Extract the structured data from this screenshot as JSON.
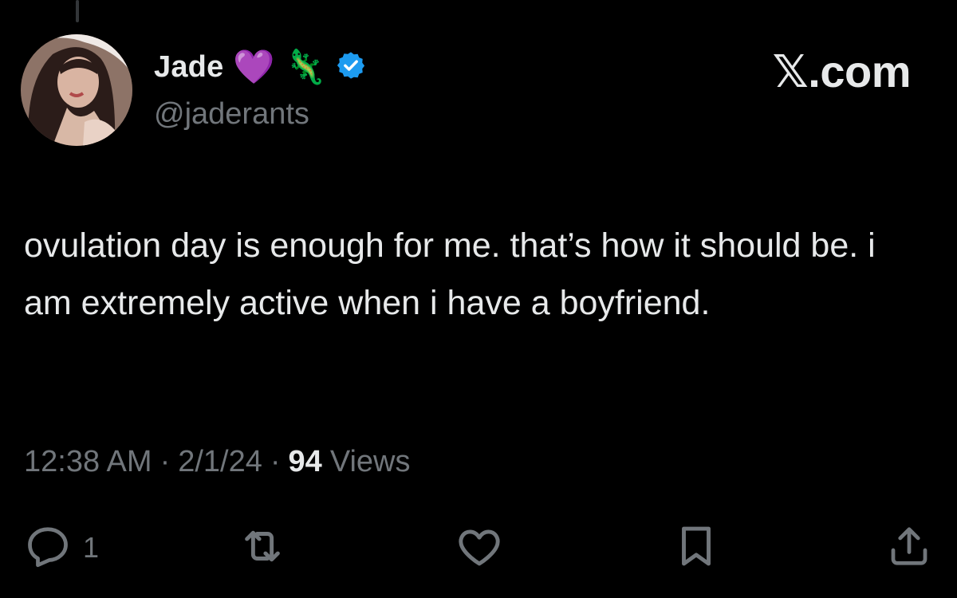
{
  "header": {
    "display_name": "Jade",
    "emoji_1": "💜",
    "emoji_2": "🦎",
    "handle": "@jaderants",
    "verified_icon": "verified-badge-icon",
    "brand": "𝕏.com"
  },
  "tweet": {
    "text": "ovulation day is enough for me. that’s how it should be. i am extremely active when i have a boyfriend."
  },
  "meta": {
    "time": "12:38 AM",
    "separator": "·",
    "date": "2/1/24",
    "views_count": "94",
    "views_label": "Views"
  },
  "actions": {
    "reply_count": "1",
    "icons": [
      "reply-icon",
      "repost-icon",
      "like-icon",
      "bookmark-icon",
      "share-icon"
    ]
  },
  "colors": {
    "background": "#000000",
    "text_primary": "#e7e9ea",
    "text_secondary": "#71767b",
    "verified": "#1d9bf0"
  }
}
